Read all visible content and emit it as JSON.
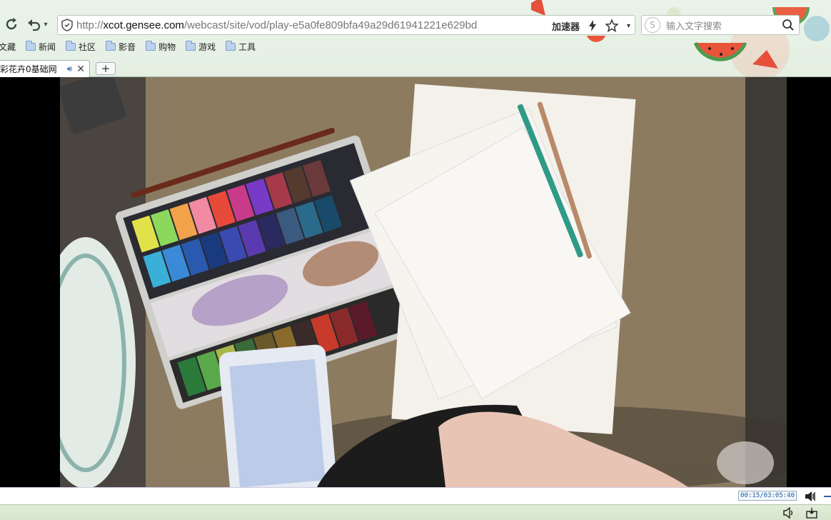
{
  "toolbar": {
    "url_prefix": "http://",
    "url_host": "xcot.gensee.com",
    "url_path": "/webcast/site/vod/play-e5a0fe809bfa49a29d61941221e629bd",
    "accelerator_label": "加速器",
    "search_placeholder": "输入文字搜索"
  },
  "bookmarks": [
    {
      "label": "文藏"
    },
    {
      "label": "新闻"
    },
    {
      "label": "社区"
    },
    {
      "label": "影音"
    },
    {
      "label": "购物"
    },
    {
      "label": "游戏"
    },
    {
      "label": "工具"
    }
  ],
  "tab": {
    "title": "彩花卉0基础网",
    "new_tab_label": "+"
  },
  "player": {
    "time": "00:15/03:05:40"
  },
  "colors": {
    "chrome_bg": "#e4efe2",
    "url_host": "#111111",
    "accent_blue": "#2d62b0"
  },
  "icons": [
    "refresh-icon",
    "undo-icon",
    "shield-icon",
    "lightning-icon",
    "star-icon",
    "search-icon",
    "folder-icon",
    "audio-icon",
    "close-icon",
    "volume-icon"
  ]
}
